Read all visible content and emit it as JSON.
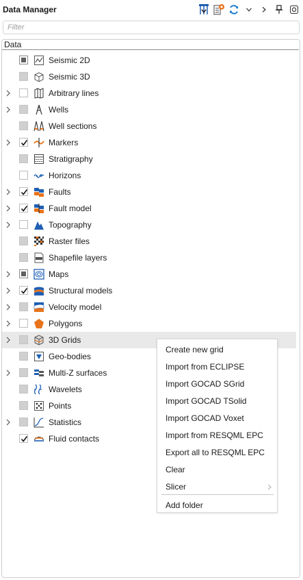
{
  "header": {
    "title": "Data Manager",
    "toolbar_icons": [
      "import-well-icon",
      "import-file-icon",
      "refresh-icon",
      "chevron-down-icon",
      "chevron-right-icon",
      "pin-icon",
      "settings-icon"
    ]
  },
  "filter": {
    "placeholder": "Filter"
  },
  "tree": {
    "column_header": "Data",
    "items": [
      {
        "label": "Seismic 2D",
        "icon": "seismic-2d-icon",
        "expandable": false,
        "check": "partial-dark"
      },
      {
        "label": "Seismic 3D",
        "icon": "seismic-3d-icon",
        "expandable": false,
        "check": "partial"
      },
      {
        "label": "Arbitrary lines",
        "icon": "arbitrary-lines-icon",
        "expandable": true,
        "check": "unchecked"
      },
      {
        "label": "Wells",
        "icon": "wells-icon",
        "expandable": true,
        "check": "partial"
      },
      {
        "label": "Well sections",
        "icon": "well-sections-icon",
        "expandable": false,
        "check": "partial"
      },
      {
        "label": "Markers",
        "icon": "markers-icon",
        "expandable": true,
        "check": "checked"
      },
      {
        "label": "Stratigraphy",
        "icon": "stratigraphy-icon",
        "expandable": false,
        "check": "partial"
      },
      {
        "label": "Horizons",
        "icon": "horizons-icon",
        "expandable": false,
        "check": "unchecked"
      },
      {
        "label": "Faults",
        "icon": "faults-icon",
        "expandable": true,
        "check": "checked"
      },
      {
        "label": "Fault model",
        "icon": "fault-model-icon",
        "expandable": true,
        "check": "checked"
      },
      {
        "label": "Topography",
        "icon": "topography-icon",
        "expandable": true,
        "check": "unchecked"
      },
      {
        "label": "Raster files",
        "icon": "raster-files-icon",
        "expandable": false,
        "check": "partial"
      },
      {
        "label": "Shapefile layers",
        "icon": "shapefile-icon",
        "expandable": false,
        "check": "partial"
      },
      {
        "label": "Maps",
        "icon": "maps-icon",
        "expandable": true,
        "check": "partial-dark"
      },
      {
        "label": "Structural models",
        "icon": "structural-models-icon",
        "expandable": true,
        "check": "checked"
      },
      {
        "label": "Velocity model",
        "icon": "velocity-model-icon",
        "expandable": true,
        "check": "partial"
      },
      {
        "label": "Polygons",
        "icon": "polygons-icon",
        "expandable": true,
        "check": "unchecked"
      },
      {
        "label": "3D Grids",
        "icon": "3d-grids-icon",
        "expandable": true,
        "check": "partial",
        "highlighted": true
      },
      {
        "label": "Geo-bodies",
        "icon": "geo-bodies-icon",
        "expandable": false,
        "check": "partial"
      },
      {
        "label": "Multi-Z surfaces",
        "icon": "multi-z-surfaces-icon",
        "expandable": true,
        "check": "partial"
      },
      {
        "label": "Wavelets",
        "icon": "wavelets-icon",
        "expandable": false,
        "check": "partial"
      },
      {
        "label": "Points",
        "icon": "points-icon",
        "expandable": false,
        "check": "partial"
      },
      {
        "label": "Statistics",
        "icon": "statistics-icon",
        "expandable": true,
        "check": "partial"
      },
      {
        "label": "Fluid contacts",
        "icon": "fluid-contacts-icon",
        "expandable": false,
        "check": "checked"
      }
    ]
  },
  "context_menu": {
    "items": [
      {
        "label": "Create new grid"
      },
      {
        "label": "Import from ECLIPSE"
      },
      {
        "label": "Import GOCAD SGrid"
      },
      {
        "label": "Import GOCAD TSolid"
      },
      {
        "label": "Import GOCAD Voxet"
      },
      {
        "label": "Import from RESQML EPC"
      },
      {
        "label": "Export all to RESQML EPC"
      },
      {
        "label": "Clear"
      },
      {
        "label": "Slicer",
        "submenu": true
      },
      {
        "label": "Add folder"
      }
    ]
  },
  "colors": {
    "accent_blue": "#1f5fb4",
    "accent_orange": "#e8731a",
    "highlight_row": "#e9e9e9"
  }
}
